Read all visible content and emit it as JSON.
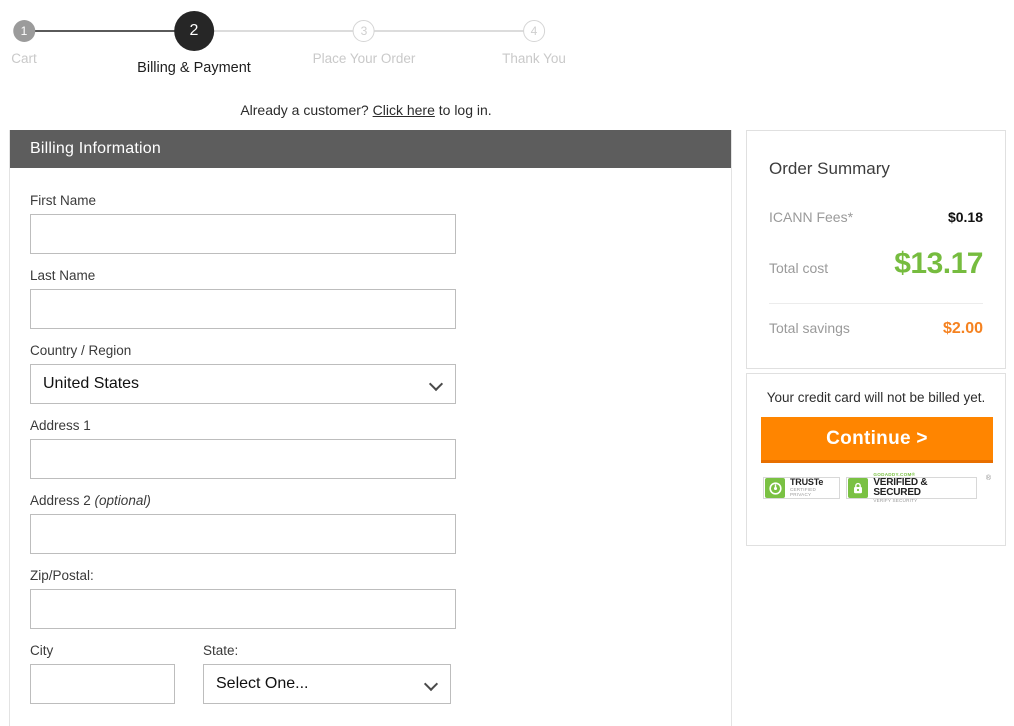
{
  "progress": {
    "steps": [
      {
        "number": "1",
        "label": "Cart",
        "state": "done"
      },
      {
        "number": "2",
        "label": "Billing & Payment",
        "state": "current"
      },
      {
        "number": "3",
        "label": "Place Your Order",
        "state": "todo"
      },
      {
        "number": "4",
        "label": "Thank You",
        "state": "todo"
      }
    ]
  },
  "login_prompt": {
    "before": "Already a customer? ",
    "link": "Click here",
    "after": " to log in."
  },
  "billing": {
    "header": "Billing Information",
    "fields": {
      "first_name": {
        "label": "First Name",
        "value": "",
        "placeholder": ""
      },
      "last_name": {
        "label": "Last Name",
        "value": "",
        "placeholder": ""
      },
      "country": {
        "label": "Country / Region",
        "value": "United States"
      },
      "address1": {
        "label": "Address 1",
        "value": "",
        "placeholder": ""
      },
      "address2": {
        "label": "Address 2 ",
        "label_optional": "(optional)",
        "value": "",
        "placeholder": ""
      },
      "zip": {
        "label": "Zip/Postal:",
        "value": "",
        "placeholder": ""
      },
      "city": {
        "label": "City",
        "value": "",
        "placeholder": ""
      },
      "state": {
        "label": "State:",
        "value": "Select One..."
      }
    }
  },
  "order_summary": {
    "title": "Order Summary",
    "rows": [
      {
        "label": "ICANN Fees*",
        "value": "$0.18"
      },
      {
        "label": "Total cost",
        "value": "$13.17"
      },
      {
        "label": "Total savings",
        "value": "$2.00"
      }
    ]
  },
  "checkout": {
    "billed_note": "Your credit card will not be billed yet.",
    "continue_label": "Continue >"
  },
  "badges": {
    "truste": {
      "title": "TRUSTe",
      "sub": "CERTIFIED PRIVACY"
    },
    "godaddy": {
      "top": "GODADDY.COM®",
      "title": "VERIFIED & SECURED",
      "sub": "VERIFY SECURITY",
      "mark": "®"
    }
  },
  "colors": {
    "accent_orange": "#ff8500",
    "total_green": "#76bc3f",
    "savings_orange": "#f58220",
    "header_gray": "#5d5d5d",
    "current_step": "#262626"
  }
}
